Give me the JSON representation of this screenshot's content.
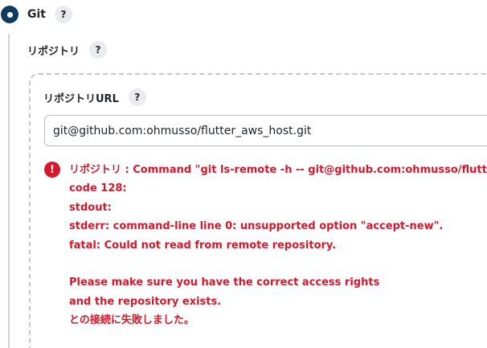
{
  "scm": {
    "option_label": "Git",
    "help_symbol": "?"
  },
  "repositories": {
    "title": "リポジトリ",
    "help_symbol": "?"
  },
  "repository_url": {
    "label": "リポジトリURL",
    "help_symbol": "?",
    "value": "git@github.com:ohmusso/flutter_aws_host.git"
  },
  "error": {
    "icon_symbol": "!",
    "lines": [
      "リポジトリ : Command \"git ls-remote -h -- git@github.com:ohmusso/flutter_",
      "code 128:",
      "stdout:",
      "stderr: command-line line 0: unsupported option \"accept-new\".",
      "fatal: Could not read from remote repository.",
      "",
      "Please make sure you have the correct access rights",
      "and the repository exists.",
      "との接続に失敗しました。"
    ]
  },
  "colors": {
    "radio_fill": "#0f3b5f",
    "error_red": "#d6182c",
    "help_bg": "#e9ebee",
    "nest_line": "#cfd3d8"
  }
}
